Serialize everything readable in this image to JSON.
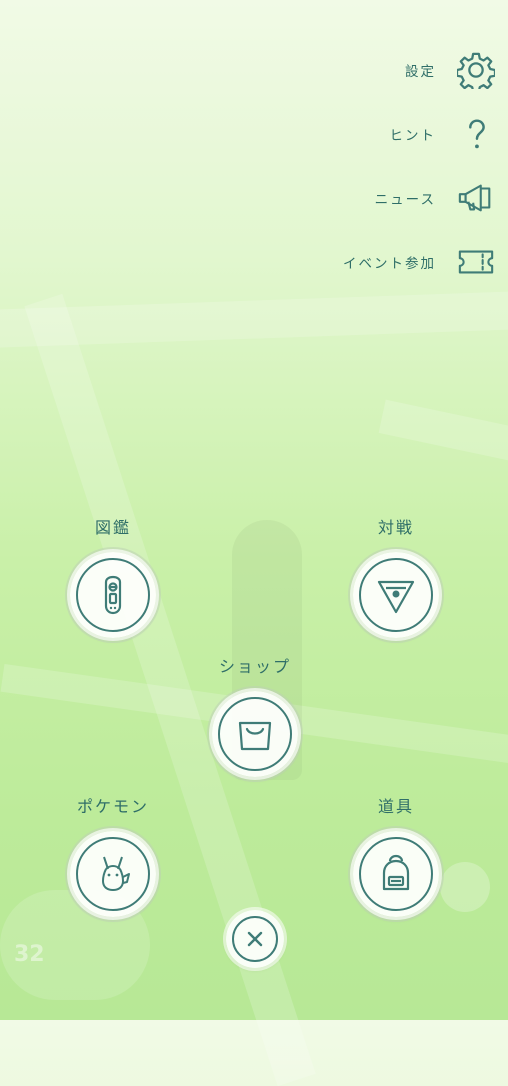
{
  "top_menu": {
    "settings": {
      "label": "設定",
      "icon": "gear-icon"
    },
    "tips": {
      "label": "ヒント",
      "icon": "question-icon"
    },
    "news": {
      "label": "ニュース",
      "icon": "megaphone-icon"
    },
    "event": {
      "label": "イベント参加",
      "icon": "ticket-icon"
    }
  },
  "actions": {
    "pokedex": {
      "label": "図鑑",
      "icon": "pokedex-icon"
    },
    "battle": {
      "label": "対戦",
      "icon": "battle-icon"
    },
    "shop": {
      "label": "ショップ",
      "icon": "shopping-bag-icon"
    },
    "pokemon": {
      "label": "ポケモン",
      "icon": "pikachu-icon"
    },
    "items": {
      "label": "道具",
      "icon": "backpack-icon"
    }
  },
  "close": {
    "icon": "close-icon"
  },
  "background": {
    "level": "32"
  },
  "colors": {
    "accent": "#3f7c77",
    "text": "#2f6e68"
  }
}
